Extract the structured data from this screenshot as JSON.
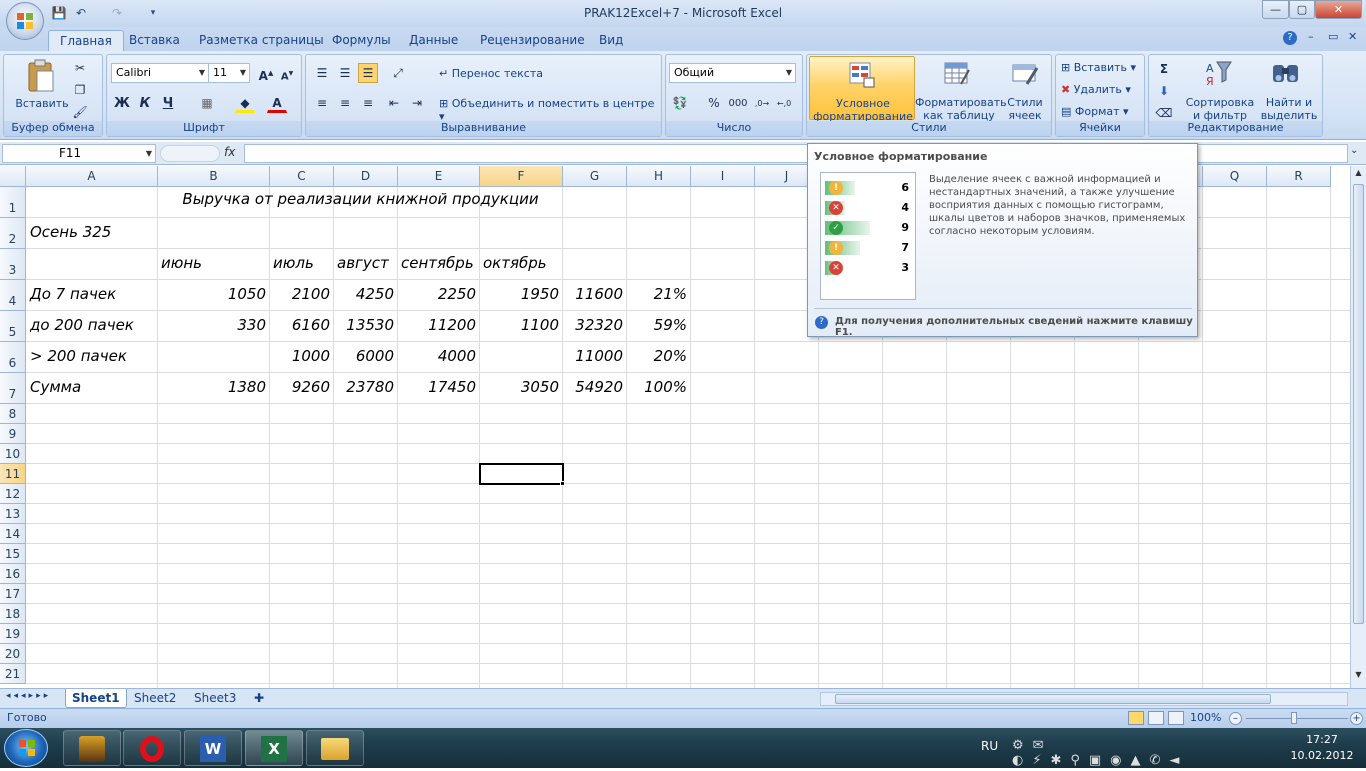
{
  "window": {
    "title": "PRAK12Excel+7 - Microsoft Excel"
  },
  "tabs": [
    "Главная",
    "Вставка",
    "Разметка страницы",
    "Формулы",
    "Данные",
    "Рецензирование",
    "Вид"
  ],
  "ribbon": {
    "clipboard": {
      "paste": "Вставить",
      "label": "Буфер обмена"
    },
    "font": {
      "name": "Calibri",
      "size": "11",
      "bold": "Ж",
      "italic": "К",
      "underline": "Ч",
      "label": "Шрифт"
    },
    "alignment": {
      "wrap": "Перенос текста",
      "merge": "Объединить и поместить в центре",
      "label": "Выравнивание"
    },
    "number": {
      "format": "Общий",
      "percent": "%",
      "thousands": "000",
      "label": "Число"
    },
    "styles": {
      "conditional1": "Условное",
      "conditional2": "форматирование",
      "table1": "Форматировать",
      "table2": "как таблицу",
      "cell1": "Стили",
      "cell2": "ячеек",
      "label": "Стили"
    },
    "cells": {
      "insert": "Вставить",
      "delete": "Удалить",
      "format": "Формат",
      "label": "Ячейки"
    },
    "editing": {
      "sort1": "Сортировка",
      "sort2": "и фильтр",
      "find1": "Найти и",
      "find2": "выделить",
      "label": "Редактирование"
    }
  },
  "formula_bar": {
    "name_box": "F11",
    "fx": "fx",
    "formula": ""
  },
  "columns": [
    "A",
    "B",
    "C",
    "D",
    "E",
    "F",
    "G",
    "H",
    "I",
    "J",
    "K",
    "L",
    "M",
    "N",
    "O",
    "P",
    "Q",
    "R"
  ],
  "rows": [
    "1",
    "2",
    "3",
    "4",
    "5",
    "6",
    "7",
    "8",
    "9",
    "10",
    "11",
    "12",
    "13",
    "14",
    "15",
    "16",
    "17",
    "18",
    "19",
    "20",
    "21"
  ],
  "cells": {
    "title": "Выручка от реализации книжной продукции",
    "r2a": "Осень 325",
    "months": [
      "июнь",
      "июль",
      "август",
      "сентябрь",
      "октябрь"
    ],
    "data": [
      {
        "label": "До 7 пачек",
        "vals": [
          "1050",
          "2100",
          "4250",
          "2250",
          "1950",
          "11600",
          "21%"
        ]
      },
      {
        "label": "до 200 пачек",
        "vals": [
          "330",
          "6160",
          "13530",
          "11200",
          "1100",
          "32320",
          "59%"
        ]
      },
      {
        "label": "> 200 пачек",
        "vals": [
          "",
          "1000",
          "6000",
          "4000",
          "",
          "11000",
          "20%"
        ]
      },
      {
        "label": "Сумма",
        "vals": [
          "1380",
          "9260",
          "23780",
          "17450",
          "3050",
          "54920",
          "100%"
        ]
      }
    ]
  },
  "tooltip": {
    "title": "Условное форматирование",
    "body": "Выделение ячеек с важной информацией и нестандартных значений, а также улучшение восприятия данных с помощью гистограмм, шкалы цветов и наборов значков, применяемых согласно некоторым условиям.",
    "footer": "Для получения дополнительных сведений нажмите клавишу F1.",
    "sample_values": [
      "6",
      "4",
      "9",
      "7",
      "3"
    ]
  },
  "sheets": [
    "Sheet1",
    "Sheet2",
    "Sheet3"
  ],
  "status": {
    "ready": "Готово",
    "zoom": "100%"
  },
  "taskbar": {
    "lang": "RU",
    "time": "17:27",
    "date": "10.02.2012"
  }
}
